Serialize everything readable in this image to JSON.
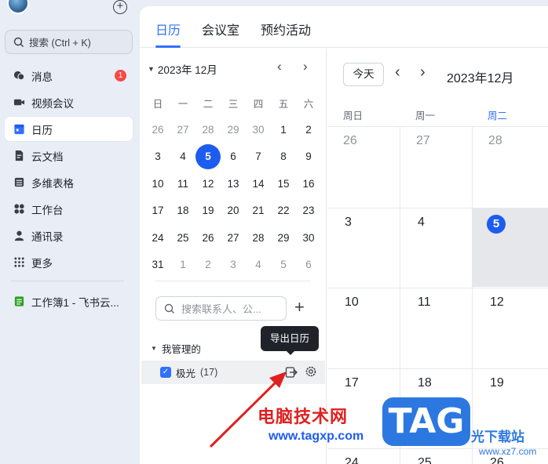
{
  "sidebar": {
    "search_label": "搜索 (Ctrl + K)",
    "items": [
      {
        "label": "消息",
        "icon": "chat-bubble-icon",
        "badge": "1"
      },
      {
        "label": "视频会议",
        "icon": "video-camera-icon"
      },
      {
        "label": "日历",
        "icon": "calendar-icon",
        "active": true
      },
      {
        "label": "云文档",
        "icon": "document-icon"
      },
      {
        "label": "多维表格",
        "icon": "table-icon"
      },
      {
        "label": "工作台",
        "icon": "grid-apps-icon"
      },
      {
        "label": "通讯录",
        "icon": "contacts-icon"
      },
      {
        "label": "更多",
        "icon": "more-dots-icon"
      }
    ],
    "pinned": {
      "label": "工作簿1 - 飞书云...",
      "icon": "spreadsheet-icon"
    }
  },
  "tabs": [
    "日历",
    "会议室",
    "预约活动"
  ],
  "mini_calendar": {
    "title": "2023年 12月",
    "weekdays": [
      "日",
      "一",
      "二",
      "三",
      "四",
      "五",
      "六"
    ],
    "weeks": [
      [
        "26",
        "27",
        "28",
        "29",
        "30",
        "1",
        "2"
      ],
      [
        "3",
        "4",
        "5",
        "6",
        "7",
        "8",
        "9"
      ],
      [
        "10",
        "11",
        "12",
        "13",
        "14",
        "15",
        "16"
      ],
      [
        "17",
        "18",
        "19",
        "20",
        "21",
        "22",
        "23"
      ],
      [
        "24",
        "25",
        "26",
        "27",
        "28",
        "29",
        "30"
      ],
      [
        "31",
        "1",
        "2",
        "3",
        "4",
        "5",
        "6"
      ]
    ],
    "today": "5"
  },
  "contact_search_placeholder": "搜索联系人、公...",
  "calendar_group": {
    "title": "我管理的",
    "calendars": [
      {
        "name": "极光",
        "count": "(17)",
        "checked": true
      }
    ]
  },
  "tooltip": "导出日历",
  "main_calendar": {
    "today_button": "今天",
    "title": "2023年12月",
    "weekdays": [
      "周日",
      "周一",
      "周二"
    ],
    "rows": [
      [
        "26",
        "27",
        "28"
      ],
      [
        "3",
        "4",
        "5"
      ],
      [
        "10",
        "11",
        "12"
      ],
      [
        "17",
        "18",
        "19"
      ],
      [
        "24",
        "25",
        "26"
      ]
    ]
  },
  "watermark": {
    "text": "电脑技术网",
    "url": "www.tagxp.com",
    "logo": "TAG",
    "site_name": "光下载站",
    "site_url": "www.xz7.com"
  },
  "colors": {
    "accent": "#3370ff",
    "today": "#1e5cf0",
    "badge": "#f54a45",
    "annotation_arrow": "#e02020"
  }
}
